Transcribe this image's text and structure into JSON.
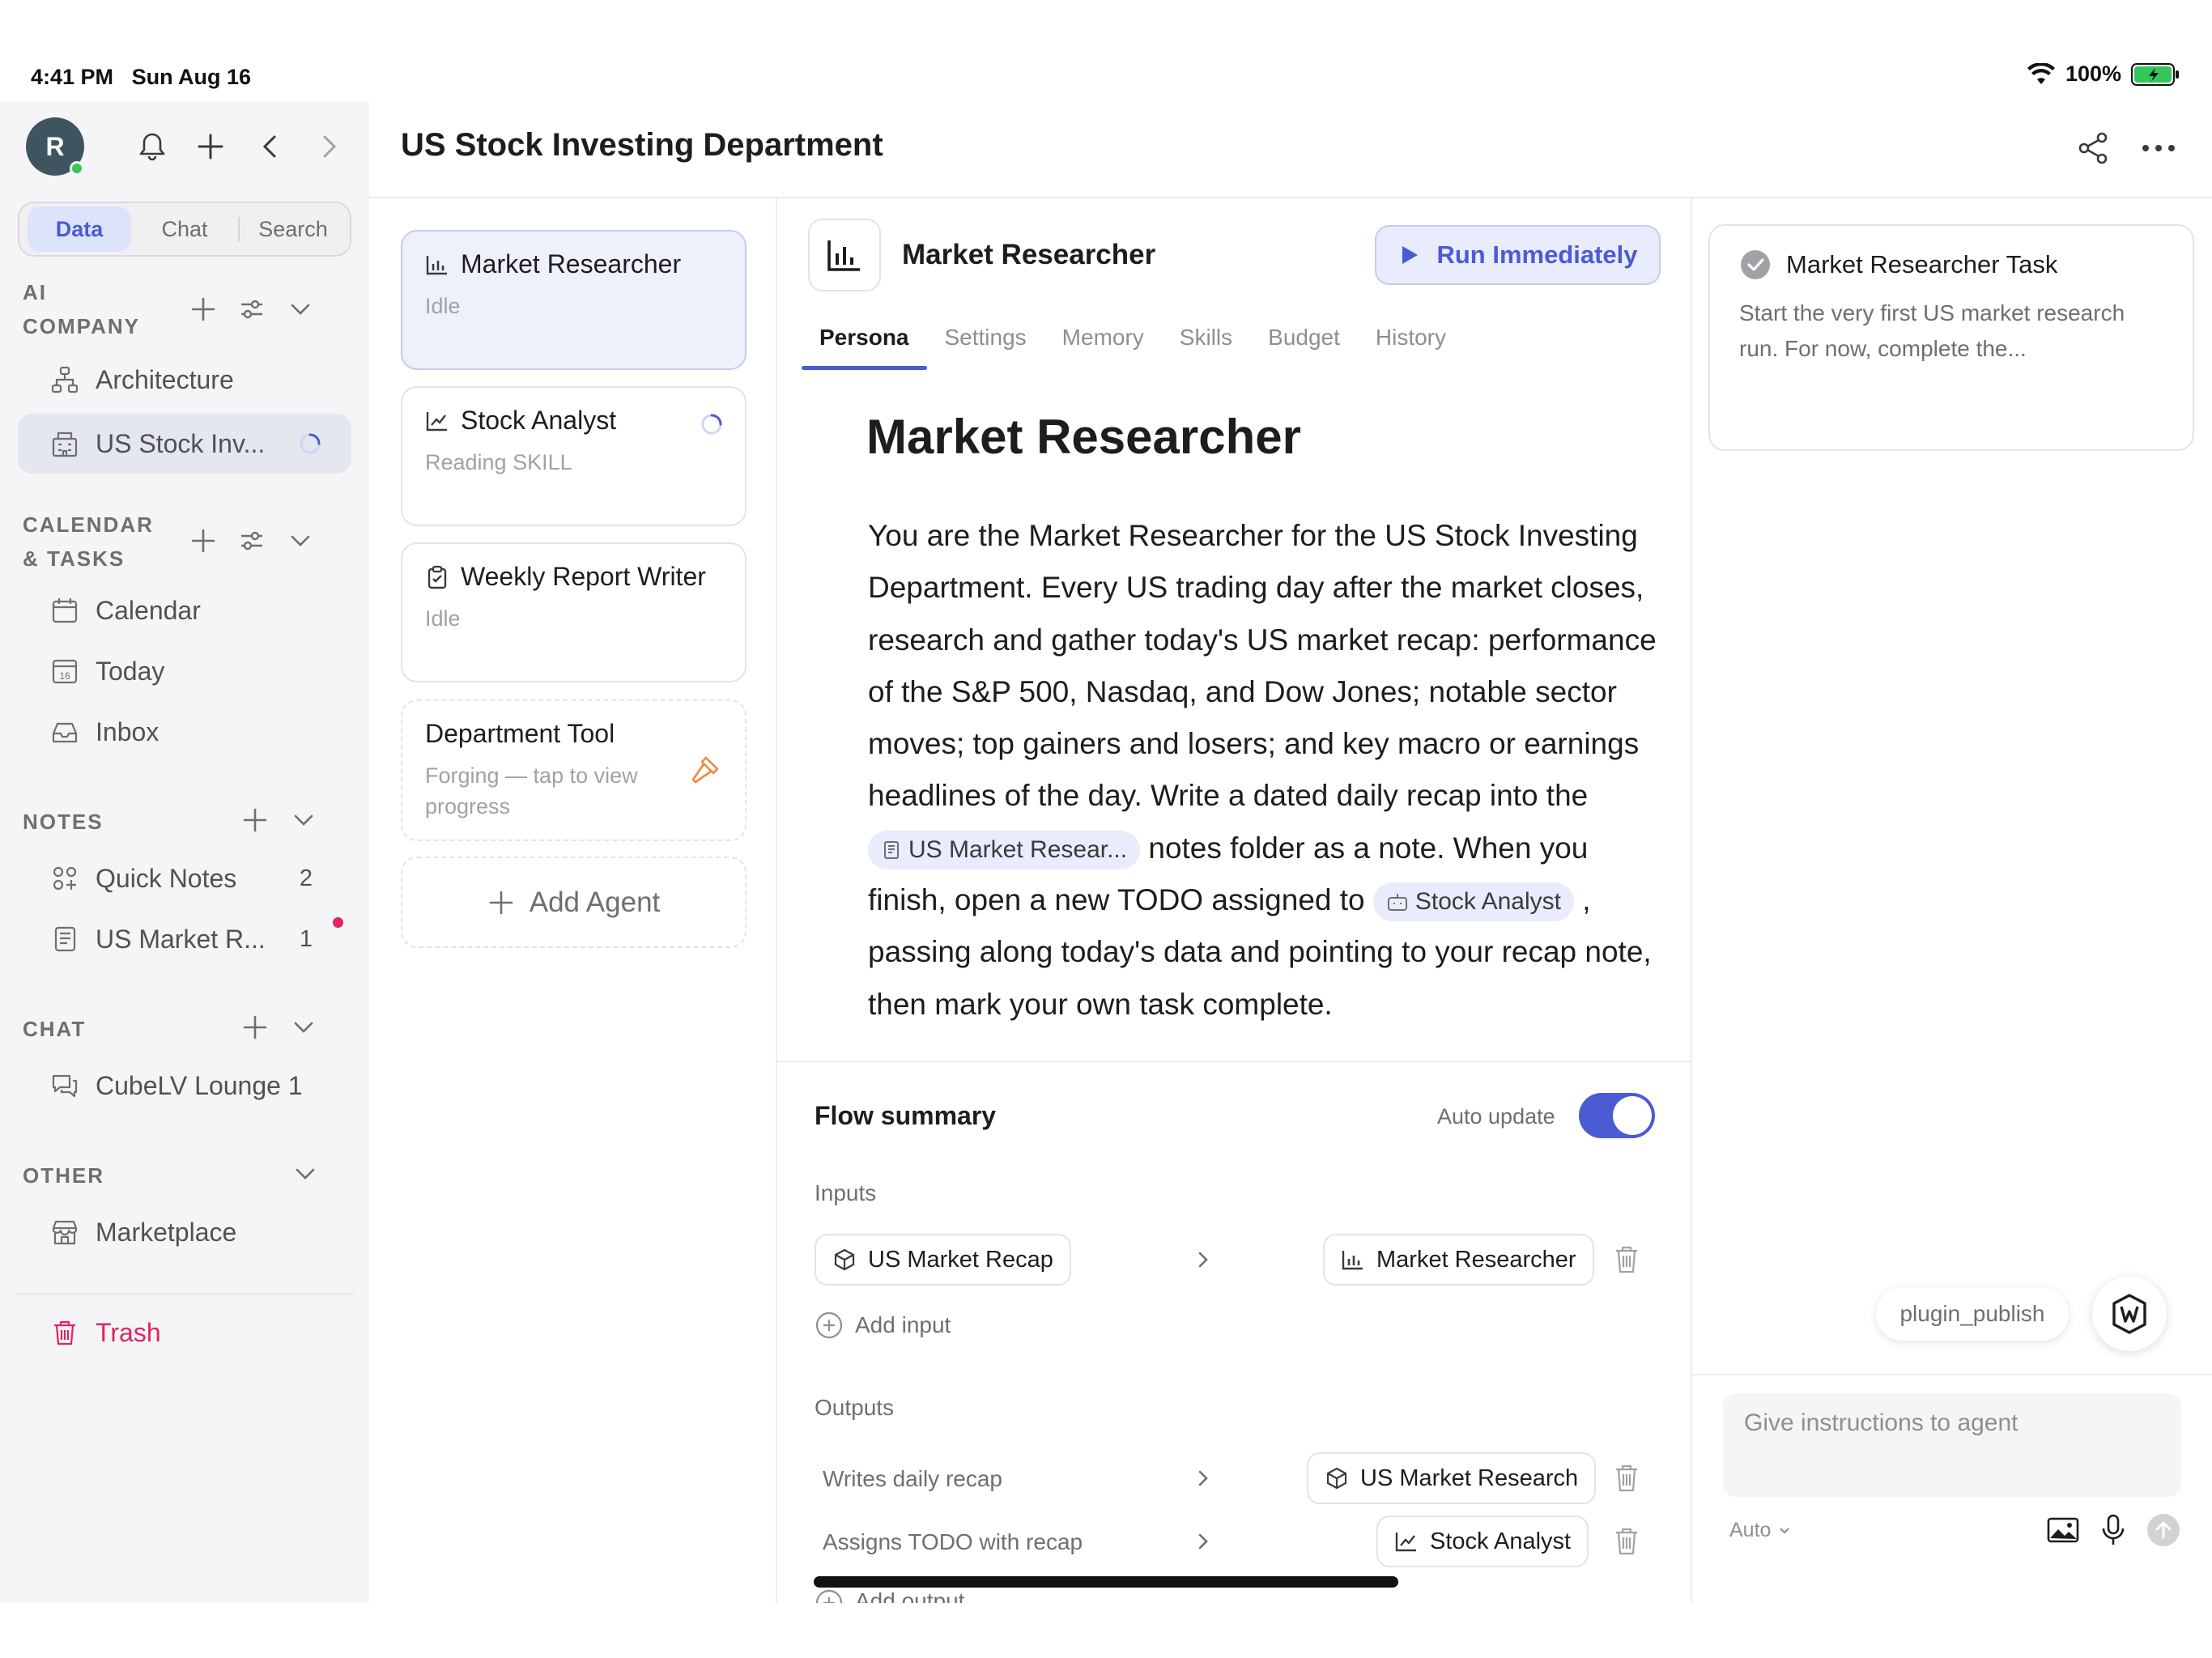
{
  "status_bar": {
    "time": "4:41 PM",
    "date": "Sun Aug 16",
    "battery": "100%"
  },
  "sidebar": {
    "avatar_letter": "R",
    "segments": [
      "Data",
      "Chat",
      "Search"
    ],
    "sections": {
      "ai_company": {
        "title_line1": "AI",
        "title_line2": "COMPANY",
        "items": [
          {
            "label": "Architecture",
            "icon": "org-chart-icon"
          },
          {
            "label": "US Stock Inv...",
            "icon": "building-icon",
            "status": "loading"
          }
        ]
      },
      "calendar": {
        "title_line1": "CALENDAR",
        "title_line2": "& TASKS",
        "items": [
          {
            "label": "Calendar",
            "icon": "calendar-icon"
          },
          {
            "label": "Today",
            "icon": "today-icon"
          },
          {
            "label": "Inbox",
            "icon": "inbox-icon"
          }
        ]
      },
      "notes": {
        "title": "NOTES",
        "items": [
          {
            "label": "Quick Notes",
            "count": "2",
            "icon": "grid-icon"
          },
          {
            "label": "US Market R...",
            "count": "1",
            "icon": "notebook-icon"
          }
        ]
      },
      "chat": {
        "title": "CHAT",
        "items": [
          {
            "label": "CubeLV Lounge 1",
            "icon": "chat-icon"
          }
        ]
      },
      "other": {
        "title": "OTHER",
        "items": [
          {
            "label": "Marketplace",
            "icon": "store-icon"
          }
        ]
      }
    },
    "trash_label": "Trash"
  },
  "header": {
    "title": "US Stock Investing Department"
  },
  "agents": [
    {
      "name": "Market Researcher",
      "status": "Idle"
    },
    {
      "name": "Stock Analyst",
      "status": "Reading SKILL"
    },
    {
      "name": "Weekly Report Writer",
      "status": "Idle"
    },
    {
      "name": "Department Tool",
      "status": "Forging — tap to view progress"
    }
  ],
  "add_agent_label": "Add Agent",
  "detail": {
    "agent_name": "Market Researcher",
    "run_label": "Run Immediately",
    "tabs": [
      "Persona",
      "Settings",
      "Memory",
      "Skills",
      "Budget",
      "History"
    ],
    "persona_title": "Market Researcher",
    "persona_text_1": "You are the Market Researcher for the US Stock Investing Department. Every US trading day after the market closes, research and gather today's US market recap: performance of the S&P 500, Nasdaq, and Dow Jones; notable sector moves; top gainers and losers; and key macro or earnings headlines of the day. Write a dated daily recap into the ",
    "persona_chip_1": "US Market Resear...",
    "persona_text_2": " notes folder as a note. When you finish, open a new TODO assigned to ",
    "persona_chip_2": "Stock Analyst",
    "persona_text_3": " , passing along today's data and pointing to your recap note, then mark your own task complete.",
    "flow": {
      "title": "Flow summary",
      "auto_update_label": "Auto update",
      "auto_update_on": true,
      "inputs_label": "Inputs",
      "input_source": "US Market Recap",
      "input_target": "Market Researcher",
      "add_input_label": "Add input",
      "outputs_label": "Outputs",
      "outputs": [
        {
          "label": "Writes daily recap",
          "target": "US Market Research"
        },
        {
          "label": "Assigns TODO with recap",
          "target": "Stock Analyst"
        }
      ],
      "add_output_label": "Add output"
    }
  },
  "right_panel": {
    "task_title": "Market Researcher Task",
    "task_desc": "Start the very first US market research run. For now, complete the...",
    "plugin_label": "plugin_publish",
    "input_placeholder": "Give instructions to agent",
    "mode_label": "Auto"
  },
  "colors": {
    "accent": "#4a5bd4",
    "accent_bg": "#e9ecfc",
    "trash": "#e0245e",
    "sidebar_bg": "#f5f5f7"
  }
}
